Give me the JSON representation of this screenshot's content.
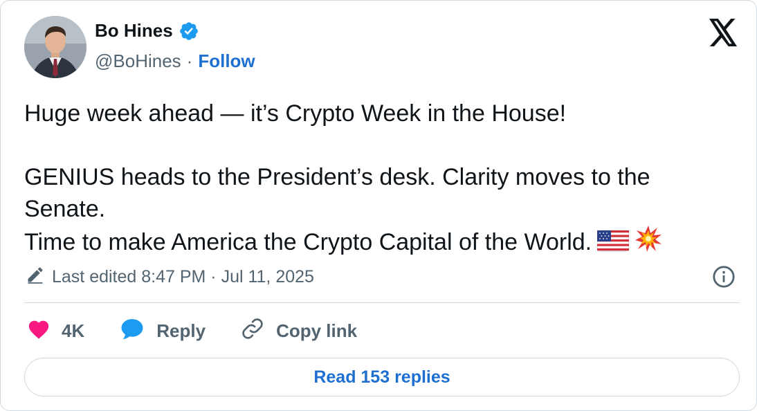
{
  "author": {
    "name": "Bo Hines",
    "handle": "@BoHines",
    "separator": "·",
    "follow_label": "Follow"
  },
  "tweet": {
    "line1": "Huge week ahead — it’s Crypto Week in the House!",
    "line2": "GENIUS heads to the President’s desk. Clarity moves to the Senate.",
    "line3": "Time to make America the Crypto Capital of the World.",
    "emojis": [
      "us-flag-icon",
      "collision-icon"
    ]
  },
  "edit_info": {
    "text": "Last edited 8:47 PM · Jul 11, 2025"
  },
  "actions": {
    "like_count": "4K",
    "reply_label": "Reply",
    "copy_link_label": "Copy link"
  },
  "read_replies_label": "Read 153 replies",
  "colors": {
    "like": "#f91880",
    "reply": "#1d9bf0",
    "link": "#1d6fd1",
    "verified": "#1d9bf0",
    "muted": "#536471",
    "border": "#cfd9de"
  }
}
